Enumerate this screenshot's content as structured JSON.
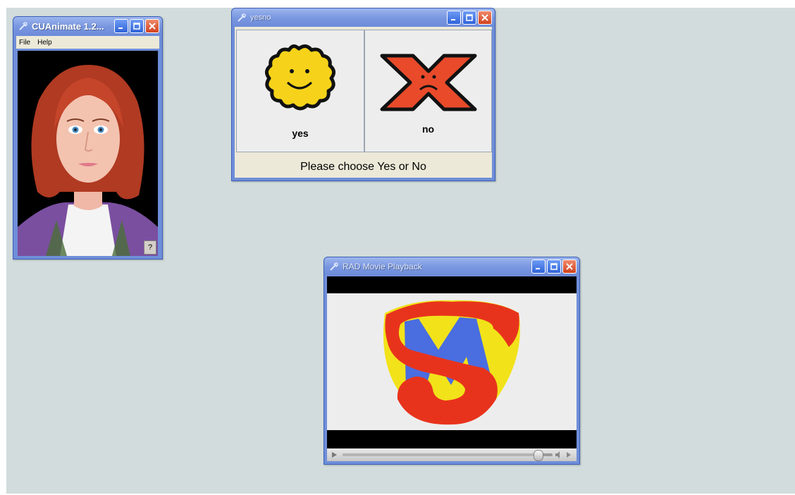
{
  "windows": {
    "cuanimate": {
      "title": "CUAnimate 1.2...",
      "menu": [
        "File",
        "Help"
      ],
      "help_button": "?"
    },
    "yesno": {
      "title": "yesno",
      "yes_label": "yes",
      "no_label": "no",
      "prompt": "Please choose Yes or No"
    },
    "rad": {
      "title": "RAD Movie Playback",
      "seek_progress": 0.93
    }
  },
  "colors": {
    "desktop": "#d2dcdc",
    "titlebar": "#7a98e0",
    "close_button": "#d1421c",
    "logo_red": "#e8331c",
    "logo_yellow": "#f2e21a",
    "logo_blue": "#4a6de0"
  },
  "icons": [
    "app-icon",
    "minimize-icon",
    "maximize-icon",
    "close-icon",
    "smiley-face-icon",
    "red-x-sad-icon",
    "play-icon",
    "volume-icon"
  ]
}
